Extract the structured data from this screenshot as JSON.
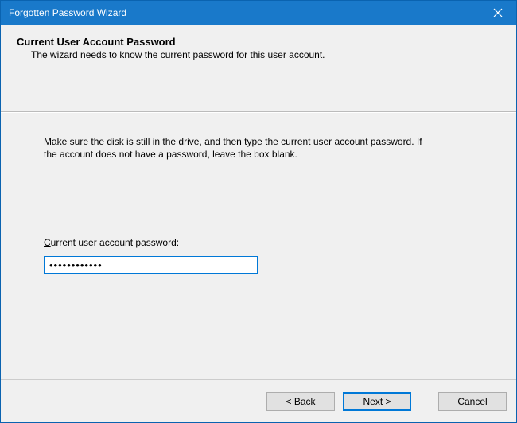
{
  "titlebar": {
    "title": "Forgotten Password Wizard"
  },
  "header": {
    "title": "Current User Account Password",
    "description": "The wizard needs to know the current password for this user account."
  },
  "content": {
    "instruction": "Make sure the disk is still in the drive, and then type the current user account password. If the account does not have a password, leave the box blank.",
    "field_label_pre": "",
    "field_label_mnemonic": "C",
    "field_label_post": "urrent user account password:",
    "password_value": "●●●●●●●●●●●●"
  },
  "footer": {
    "back_pre": "< ",
    "back_mnemonic": "B",
    "back_post": "ack",
    "next_mnemonic": "N",
    "next_post": "ext >",
    "cancel": "Cancel"
  }
}
